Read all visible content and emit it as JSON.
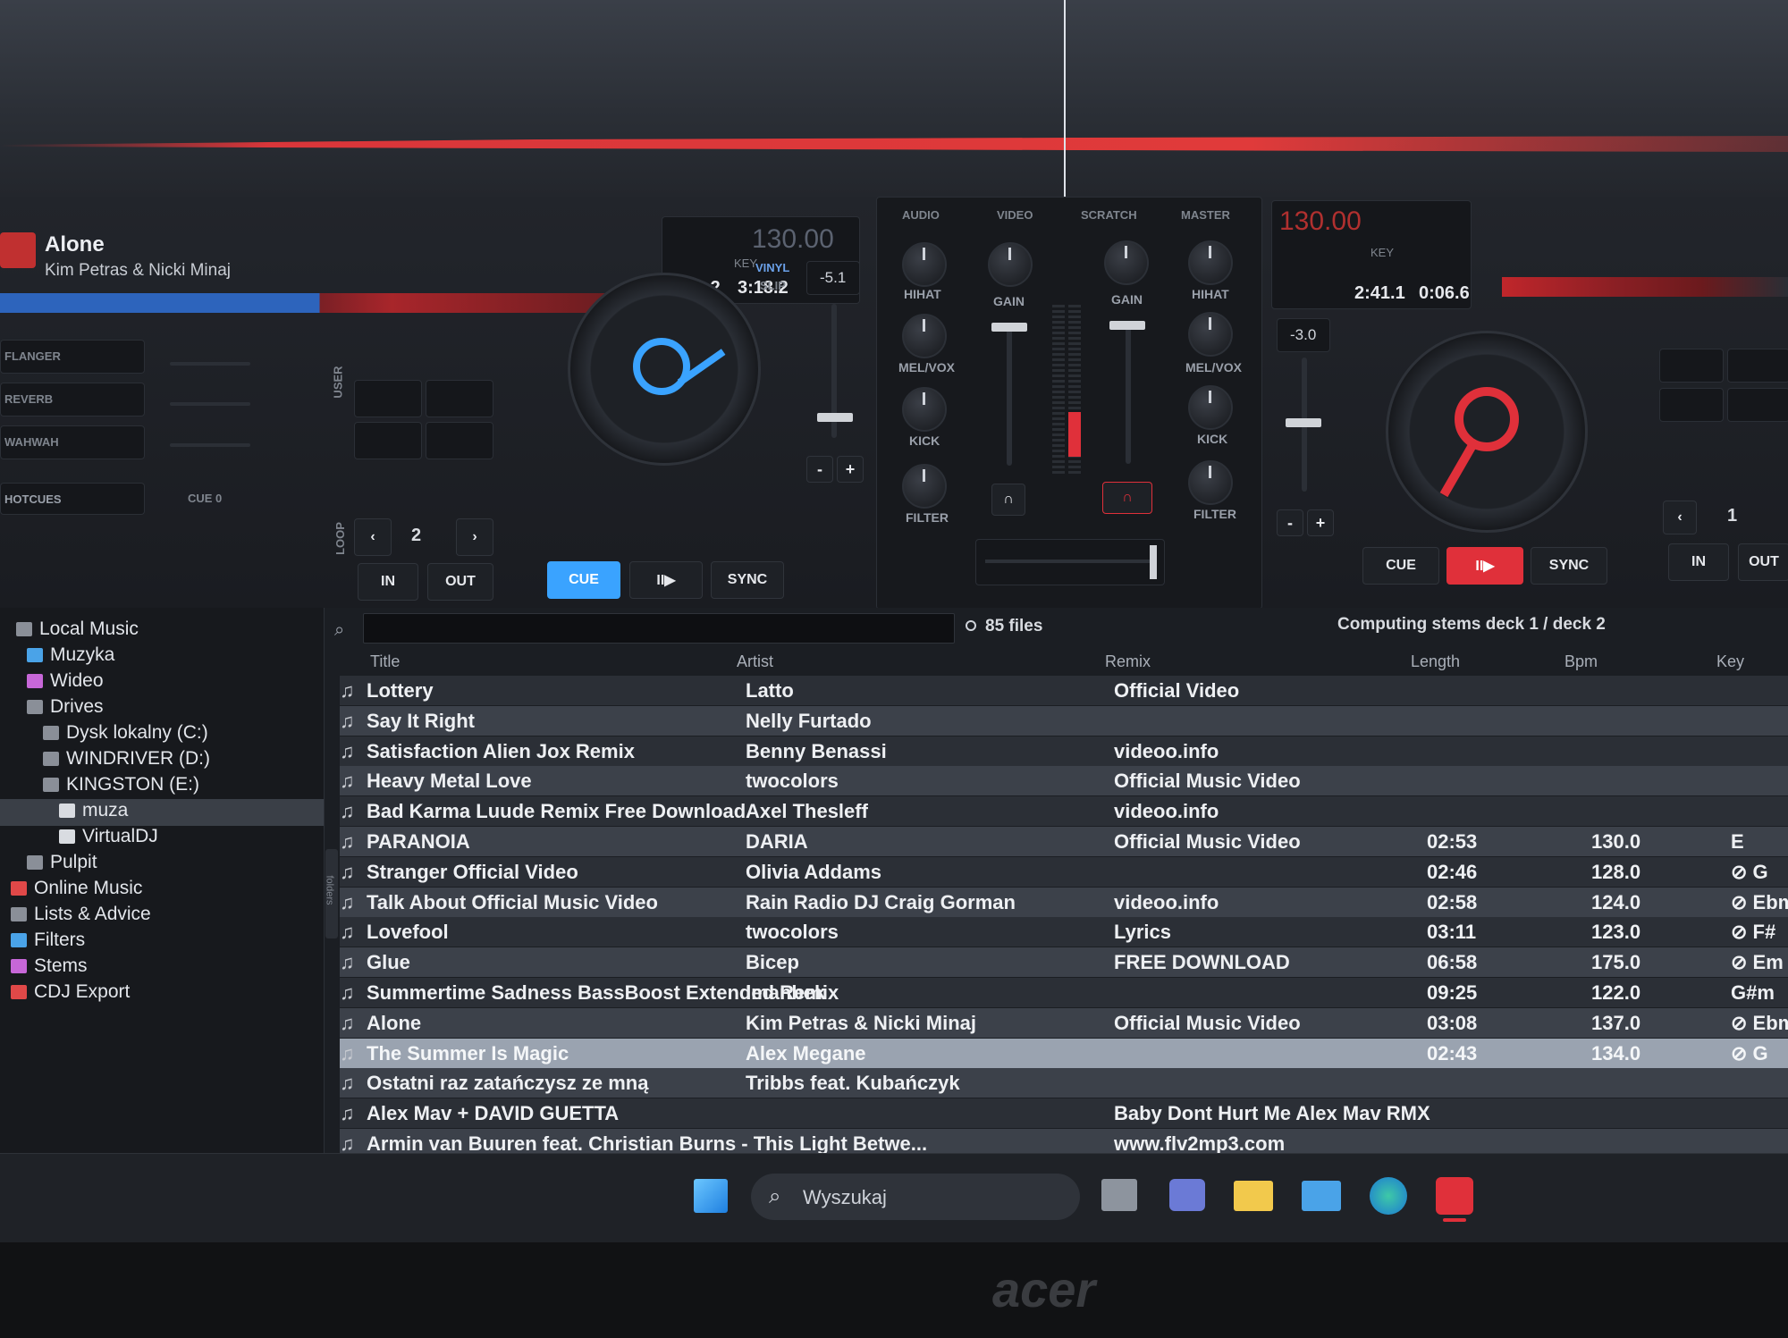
{
  "deck1": {
    "title": "Alone",
    "artist": "Kim Petras & Nicki Minaj",
    "bpm": "130.00",
    "key_label": "KEY",
    "elapsed": "0:00.2",
    "remain": "3:18.2",
    "pitch": "-5.1",
    "effects": [
      "FLANGER",
      "REVERB",
      "WAHWAH"
    ],
    "hotcues_label": "HOTCUES",
    "cue_label": "CUE 0",
    "loop_label": "LOOP",
    "loop_value": "2",
    "in_label": "IN",
    "out_label": "OUT",
    "cue_btn": "CUE",
    "play_btn": "II▶",
    "sync_btn": "SYNC",
    "vinyl_label": "VINYL",
    "slip_label": "SLIP",
    "minus": "-",
    "plus": "+",
    "user_label": "USER",
    "accent": "#3aa3ff"
  },
  "mixer": {
    "tabs": [
      "AUDIO",
      "VIDEO",
      "SCRATCH",
      "MASTER"
    ],
    "knobs": [
      "HIHAT",
      "MEL/VOX",
      "KICK",
      "FILTER"
    ],
    "gain": "GAIN"
  },
  "deck2": {
    "bpm": "130.00",
    "key_label": "KEY",
    "elapsed": "2:41.1",
    "remain": "0:06.6",
    "pitch": "-3.0",
    "cue_btn": "CUE",
    "play_btn": "II▶",
    "sync_btn": "SYNC",
    "loop_value": "1",
    "in_label": "IN",
    "out_label": "OUT",
    "minus": "-",
    "plus": "+",
    "accent": "#e0303a"
  },
  "tree": [
    {
      "label": "Local Music",
      "color": "#8a8f98"
    },
    {
      "label": "Muzyka",
      "color": "#4aa3e8"
    },
    {
      "label": "Wideo",
      "color": "#c767d8"
    },
    {
      "label": "Drives",
      "color": "#8a8f98"
    },
    {
      "label": "Dysk lokalny (C:)",
      "color": "#8a8f98"
    },
    {
      "label": "WINDRIVER (D:)",
      "color": "#8a8f98"
    },
    {
      "label": "KINGSTON (E:)",
      "color": "#8a8f98"
    },
    {
      "label": "muza",
      "color": "#d9dce1"
    },
    {
      "label": "VirtualDJ",
      "color": "#d9dce1"
    },
    {
      "label": "Pulpit",
      "color": "#8a8f98"
    },
    {
      "label": "Online Music",
      "color": "#e04848"
    },
    {
      "label": "Lists & Advice",
      "color": "#8a8f98"
    },
    {
      "label": "Filters",
      "color": "#4aa3e8"
    },
    {
      "label": "Stems",
      "color": "#c767d8"
    },
    {
      "label": "CDJ Export",
      "color": "#e04848"
    }
  ],
  "folders_tab": "folders",
  "browser": {
    "search_placeholder": "",
    "file_count": "85 files",
    "status": "Computing stems deck 1 / deck 2",
    "columns": [
      "Title",
      "Artist",
      "Remix",
      "Length",
      "Bpm",
      "Key"
    ]
  },
  "tracks": [
    {
      "title": "Lottery",
      "artist": "Latto",
      "remix": "Official Video",
      "length": "",
      "bpm": "",
      "key": ""
    },
    {
      "title": "Say It Right",
      "artist": "Nelly Furtado",
      "remix": "",
      "length": "",
      "bpm": "",
      "key": ""
    },
    {
      "title": "Satisfaction Alien Jox Remix",
      "artist": "Benny Benassi",
      "remix": "videoo.info",
      "length": "",
      "bpm": "",
      "key": ""
    },
    {
      "title": "Heavy Metal Love",
      "artist": "twocolors",
      "remix": "Official Music Video",
      "length": "",
      "bpm": "",
      "key": ""
    },
    {
      "title": "Bad Karma Luude Remix Free Download",
      "artist": "Axel Thesleff",
      "remix": "videoo.info",
      "length": "",
      "bpm": "",
      "key": ""
    },
    {
      "title": "PARANOIA",
      "artist": "DARIA",
      "remix": "Official Music Video",
      "length": "02:53",
      "bpm": "130.0",
      "key": "E"
    },
    {
      "title": "Stranger  Official Video",
      "artist": "Olivia Addams",
      "remix": "",
      "length": "02:46",
      "bpm": "128.0",
      "key": "⊘ G"
    },
    {
      "title": "Talk About Official Music Video",
      "artist": "Rain Radio DJ Craig Gorman",
      "remix": "videoo.info",
      "length": "02:58",
      "bpm": "124.0",
      "key": "⊘ Ebm"
    },
    {
      "title": "Lovefool",
      "artist": "twocolors",
      "remix": "Lyrics",
      "length": "03:11",
      "bpm": "123.0",
      "key": "⊘ F#"
    },
    {
      "title": "Glue",
      "artist": "Bicep",
      "remix": "FREE DOWNLOAD",
      "length": "06:58",
      "bpm": "175.0",
      "key": "⊘ Em"
    },
    {
      "title": "Summertime Sadness  BassBoost  Extended Remix",
      "artist": "Imanbek",
      "remix": "",
      "length": "09:25",
      "bpm": "122.0",
      "key": "G#m"
    },
    {
      "title": "Alone",
      "artist": "Kim Petras & Nicki Minaj",
      "remix": "Official Music Video",
      "length": "03:08",
      "bpm": "137.0",
      "key": "⊘ Ebm"
    },
    {
      "title": "The Summer Is Magic",
      "artist": "Alex Megane",
      "remix": "",
      "length": "02:43",
      "bpm": "134.0",
      "key": "⊘ G"
    },
    {
      "title": "Ostatni raz zatańczysz ze mną",
      "artist": "Tribbs feat. Kubańczyk",
      "remix": "",
      "length": "",
      "bpm": "",
      "key": ""
    },
    {
      "title": "Alex Mav + DAVID GUETTA",
      "artist": "",
      "remix": "Baby Dont Hurt Me  Alex Mav RMX",
      "length": "",
      "bpm": "",
      "key": ""
    },
    {
      "title": "Armin van Buuren feat. Christian Burns - This Light Betwe...",
      "artist": "",
      "remix": "www.flv2mp3.com",
      "length": "",
      "bpm": "",
      "key": ""
    }
  ],
  "taskbar": {
    "search_label": "Wyszukaj"
  },
  "bezel_logo": "acer"
}
